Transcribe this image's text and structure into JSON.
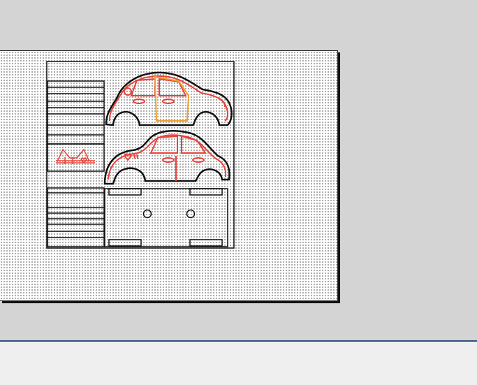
{
  "app": {
    "colors": {
      "workspace_bg": "#d4d4d4",
      "canvas_bg": "#ffffff",
      "grid_dot": "#9a9a9a",
      "cut_line": "#111111",
      "engrave_red": "#e8423a",
      "engrave_orange": "#f0a030",
      "panel_bg": "#efefef",
      "panel_border": "#2f4f7f"
    }
  },
  "design": {
    "pieces": [
      {
        "name": "car-side-panel-top",
        "engraving": "doors-and-windows"
      },
      {
        "name": "car-side-panel-bottom",
        "engraving": "doors-windows-and-heart"
      },
      {
        "name": "car-base-plate",
        "holes": 2
      },
      {
        "name": "slat-stack-upper"
      },
      {
        "name": "slat-stack-lower"
      },
      {
        "name": "cat-ears-strip",
        "engraving": "cat-ears-with-hearts"
      }
    ]
  }
}
